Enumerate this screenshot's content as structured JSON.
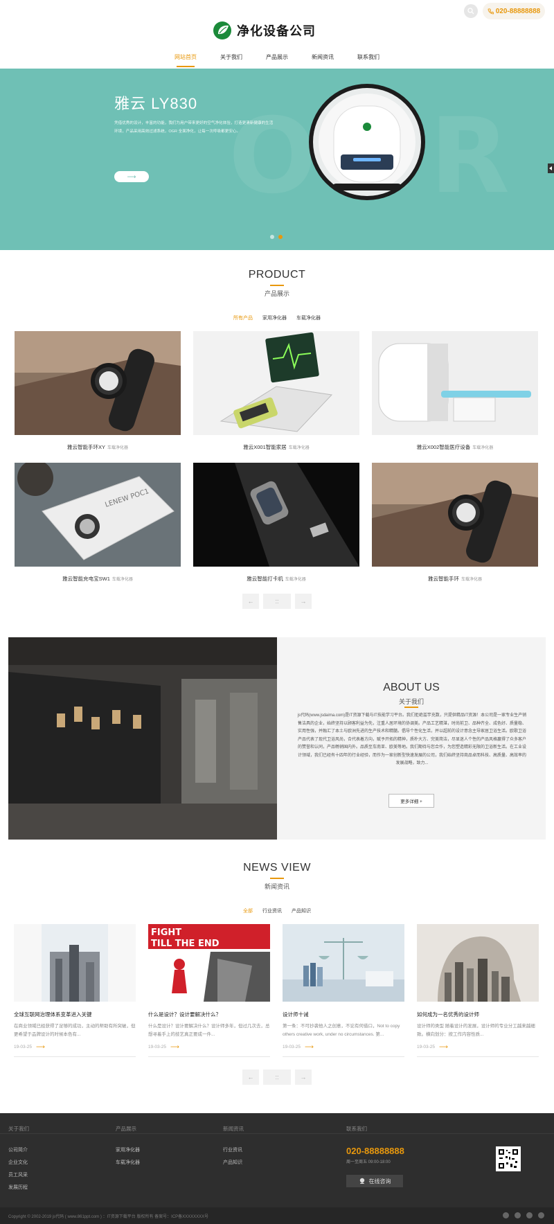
{
  "header": {
    "logo_text": "净化设备公司",
    "phone": "020-88888888",
    "nav": [
      "网站首页",
      "关于我们",
      "产品展示",
      "新闻资讯",
      "联系我们"
    ]
  },
  "banner": {
    "title": "雅云 LY830",
    "desc": "凭借优秀的设计，丰富的功能，我们为用户带来更好的空气净化体验，打造更清新健康的生活环境，产品采用高效过滤系统，OGR 全面净化，让每一次呼吸都更安心。",
    "button_arrow": "⟶",
    "ghost_text": "OGR",
    "slides": 2,
    "active_slide": 2
  },
  "product": {
    "en": "PRODUCT",
    "cn": "产品展示",
    "filters": [
      "所有产品",
      "家用净化器",
      "车载净化器"
    ],
    "items": [
      {
        "name": "雅云智能手环XY",
        "tag": "车载净化器"
      },
      {
        "name": "雅云X001智能家居",
        "tag": "车载净化器"
      },
      {
        "name": "雅云X002智能医疗设备",
        "tag": "车载净化器"
      },
      {
        "name": "雅云智能充电宝SW1",
        "tag": "车载净化器"
      },
      {
        "name": "雅云智能打卡机",
        "tag": "车载净化器"
      },
      {
        "name": "雅云智能手环",
        "tag": "车载净化器"
      }
    ],
    "pager": [
      "←",
      "::",
      "→"
    ]
  },
  "about": {
    "en": "ABOUT US",
    "cn": "关于我们",
    "text": "js代码(www.jsdaima.com)是IT资源下载与IT技能学习平台。我们拒绝滥竽充数，只提供精品IT资源！本公司是一家专业生产销售洁具的企业，始终坚持以顾客利益为先，注重人居环境的协调美。产品工艺精湛，时尚前卫、品种齐全、成色好、质量稳、实用性强，并融汇了本土与欧洲先进的生产技术和精髓。倡导个性化生活，并以超前的设计意念主导家居卫浴生活。欧歌卫浴产品代表了现代卫浴风尚，合代表着方向，赋予开拓的精神，质朴大方、完美简洁，尽显迷人个性的产品风格赢得了众多客户的赞誉和认同，产品畅销国内外。品质至车南亚、欧美等地。我们期待与您合作，为您塑造精彩无限的卫浴新生活。在工业设计领域，我们已经有十四年的行业经验，而作为一家创新型快速发展的公司，我们始终坚持商品卓而科技、高质量、高效率的发展战略，致力...",
    "button": "更多详细 +"
  },
  "news": {
    "en": "NEWS VIEW",
    "cn": "新闻资讯",
    "filters": [
      "全部",
      "行业资讯",
      "产品知识"
    ],
    "items": [
      {
        "title": "全球互联网治理体系变革进入关键",
        "summary": "在商业领域已经获得了足够的成功，主动的帮助有所突破，但更希望于品牌设计的时候本色有...",
        "date": "19-03-25"
      },
      {
        "title": "什么是设计？设计要解决什么？",
        "summary": "什么是设计？设计要解决什么？设计师多年，但过几次去，总想寻着手上的技艺真正要成一件...",
        "date": "19-03-25"
      },
      {
        "title": "设计师十诫",
        "summary": "第一条：不可抄袭他人之创意，不论有何借口，Not to copy others creative work, under no circumstances. 第...",
        "date": "19-03-25"
      },
      {
        "title": "如何成为一名优秀的设计师",
        "summary": "设计师的类型 随着设计的发展，设计师的专业分工越来越细致。横向划分：按工作内容性质...",
        "date": "19-03-25"
      }
    ],
    "arrow": "⟶",
    "pager": [
      "←",
      "::",
      "→"
    ]
  },
  "footer": {
    "cols": [
      {
        "head": "关于我们",
        "items": [
          "公司简介",
          "企业文化",
          "员工风采",
          "发展历程"
        ]
      },
      {
        "head": "产品展示",
        "items": [
          "家用净化器",
          "车载净化器"
        ]
      },
      {
        "head": "新闻资讯",
        "items": [
          "行业资讯",
          "产品知识"
        ]
      }
    ],
    "contact_head": "联系我们",
    "phone": "020-88888888",
    "hours": "周一至周五 09:00-18:00",
    "consult": "在线咨询",
    "copyright": "Copyright © 2002-2019 js代码 ( www.861ppt.com ) ：IT资源下载平台 版权所有 备案号：ICP备XXXXXXXX号"
  },
  "colors": {
    "accent": "#e8980d",
    "banner": "#6fc0b5",
    "footer": "#2e2e2e"
  }
}
